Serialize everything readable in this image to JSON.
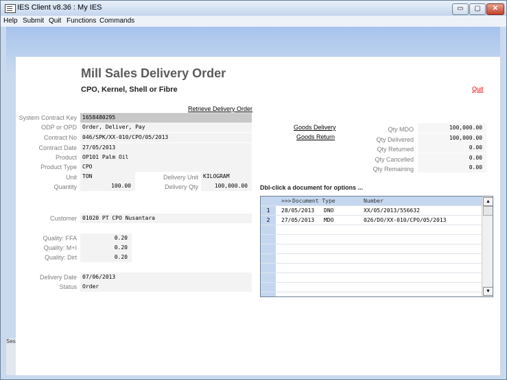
{
  "window": {
    "title": "IES Client v8.36 : My IES",
    "min_glyph": "▭",
    "max_glyph": "▢",
    "close_glyph": "✕"
  },
  "menu": [
    "Help",
    "Submit",
    "Quit",
    "Functions",
    "Commands"
  ],
  "form": {
    "title": "Mill Sales Delivery Order",
    "subtitle": "CPO, Kernel, Shell or Fibre",
    "quit_link": "Quit",
    "retrieve_link": "Retrieve Delivery Order"
  },
  "fields": {
    "system_contract_key": {
      "label": "System Contract Key",
      "value": "1658480295"
    },
    "odp_or_opd": {
      "label": "ODP or OPD",
      "value": "Order, Deliver, Pay"
    },
    "contract_no": {
      "label": "Contract No",
      "value": "046/SPK/XX-010/CPO/05/2013"
    },
    "contract_date": {
      "label": "Contract Date",
      "value": "27/05/2013"
    },
    "product": {
      "label": "Product",
      "value": "OP101 Palm Oil"
    },
    "product_type": {
      "label": "Product Type",
      "value": "CPO"
    },
    "unit": {
      "label": "Unit",
      "value": "TON"
    },
    "quantity": {
      "label": "Quantity",
      "value": "100.00"
    },
    "delivery_unit": {
      "label": "Delivery Unit",
      "value": "KILOGRAM"
    },
    "delivery_qty": {
      "label": "Delivery Qty",
      "value": "100,000.00"
    },
    "customer": {
      "label": "Customer",
      "value": "01020 PT CPO Nusantara"
    },
    "quality_ffa": {
      "label": "Quality: FFA",
      "value": "0.20"
    },
    "quality_mi": {
      "label": "Quality: M+I",
      "value": "0.20"
    },
    "quality_dirt": {
      "label": "Quality: Dirt",
      "value": "0.20"
    },
    "delivery_date": {
      "label": "Delivery Date",
      "value": "07/06/2013"
    },
    "status": {
      "label": "Status",
      "value": "Order"
    }
  },
  "links": {
    "goods_delivery": "Goods Delivery",
    "goods_return": "Goods Return"
  },
  "qty": {
    "mdo": {
      "label": "Qty MDO",
      "value": "100,000.00"
    },
    "delivered": {
      "label": "Qty Delivered",
      "value": "100,000.00"
    },
    "returned": {
      "label": "Qty Returned",
      "value": "0.00"
    },
    "cancelled": {
      "label": "Qty Cancelled",
      "value": "0.00"
    },
    "remaining": {
      "label": "Qty Remaining",
      "value": "0.00"
    }
  },
  "grid": {
    "title": "Dbl-click a document for options ...",
    "header": {
      "marker": ">>>",
      "date_type": "Document Type",
      "number": "Number"
    },
    "rows": [
      {
        "idx": "1",
        "date": "28/05/2013",
        "type": "DNO",
        "number": "XX/05/2013/556632"
      },
      {
        "idx": "2",
        "date": "27/05/2013",
        "type": "MDO",
        "number": "026/DO/XX-010/CPO/05/2013"
      }
    ],
    "scroll_up": "▲",
    "scroll_down": "▼"
  },
  "side": {
    "session_text": "Ses"
  }
}
